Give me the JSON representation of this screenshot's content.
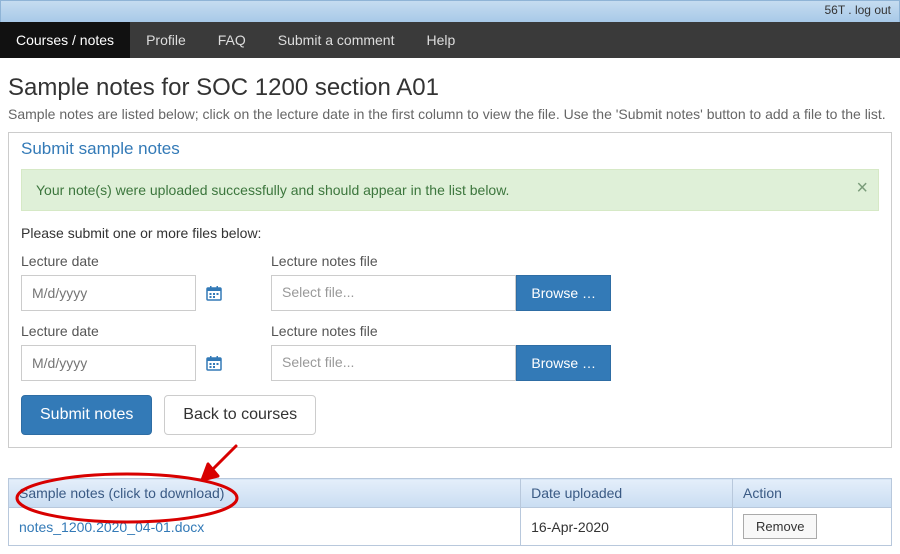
{
  "topbar": {
    "user": "56T",
    "sep": ".",
    "logout": "log out"
  },
  "nav": [
    {
      "label": "Courses / notes",
      "active": true
    },
    {
      "label": "Profile"
    },
    {
      "label": "FAQ"
    },
    {
      "label": "Submit a comment"
    },
    {
      "label": "Help"
    }
  ],
  "page": {
    "title": "Sample notes for SOC 1200 section A01",
    "subhead": "Sample notes are listed below; click on the lecture date in the first column to view the file. Use the 'Submit notes' button to add a file to the list."
  },
  "panel": {
    "title": "Submit sample notes",
    "alert": "Your note(s) were uploaded successfully and should appear in the list below.",
    "prompt": "Please submit one or more files below:",
    "labels": {
      "lecture_date": "Lecture date",
      "file": "Lecture notes file",
      "date_placeholder": "M/d/yyyy",
      "file_placeholder": "Select file...",
      "browse": "Browse …"
    },
    "submit": "Submit notes",
    "back": "Back to courses"
  },
  "table": {
    "headers": {
      "notes": "Sample notes (click to download)",
      "date": "Date uploaded",
      "action": "Action"
    },
    "rows": [
      {
        "file": "notes_1200.2020_04-01.docx",
        "date": "16-Apr-2020",
        "action": "Remove"
      }
    ]
  }
}
